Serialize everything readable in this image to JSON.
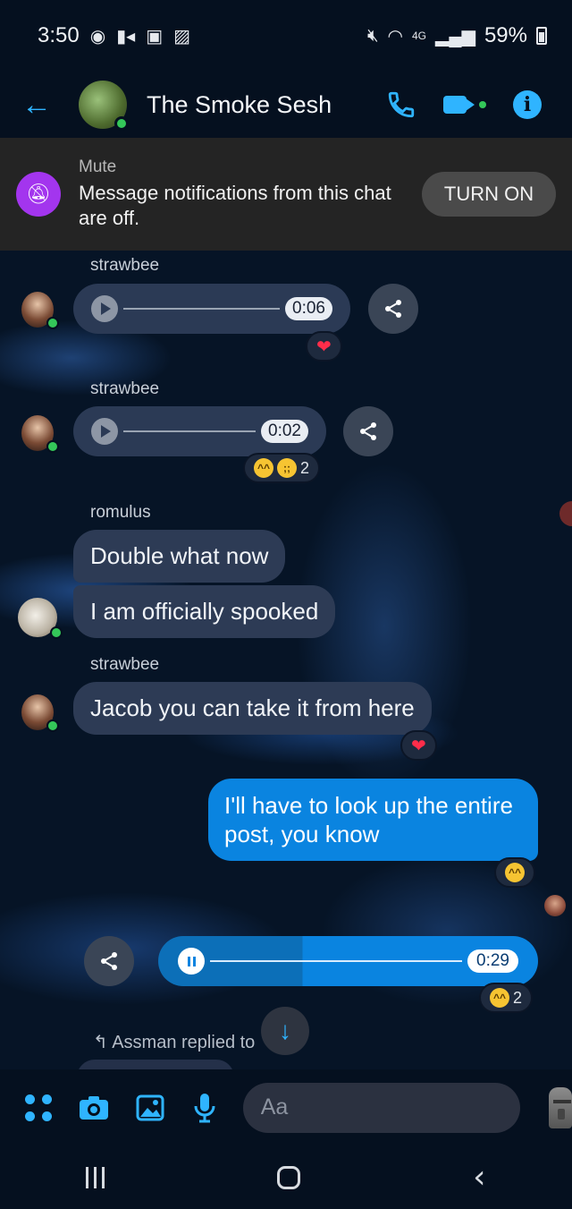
{
  "status_bar": {
    "time": "3:50",
    "network": "4G",
    "battery": "59%"
  },
  "header": {
    "chat_name": "The Smoke Sesh"
  },
  "mute_banner": {
    "title": "Mute",
    "description": "Message notifications from this chat are off.",
    "button_label": "TURN ON"
  },
  "messages": [
    {
      "sender": "strawbee",
      "type": "audio",
      "duration": "0:06",
      "reaction": "❤"
    },
    {
      "sender": "strawbee",
      "type": "audio",
      "duration": "0:02",
      "reaction_count": "2"
    },
    {
      "sender": "romulus",
      "type": "text",
      "text": "Double what now"
    },
    {
      "sender": "romulus",
      "type": "text",
      "text": "I am officially spooked"
    },
    {
      "sender": "strawbee",
      "type": "text",
      "text": "Jacob you can take it from here",
      "reaction": "❤"
    },
    {
      "sender": "me",
      "type": "text",
      "text": "I'll have to look up the entire post, you know"
    },
    {
      "sender": "me",
      "type": "audio",
      "duration": "0:29",
      "reaction_count": "2",
      "progress": 0.38
    }
  ],
  "reply_preview": "Assman replied to",
  "composer": {
    "placeholder": "Aa"
  },
  "colors": {
    "accent": "#2fb4ff",
    "outgoing": "#0a84e0",
    "incoming": "#2d3b55",
    "mute_icon": "#a335ee"
  }
}
